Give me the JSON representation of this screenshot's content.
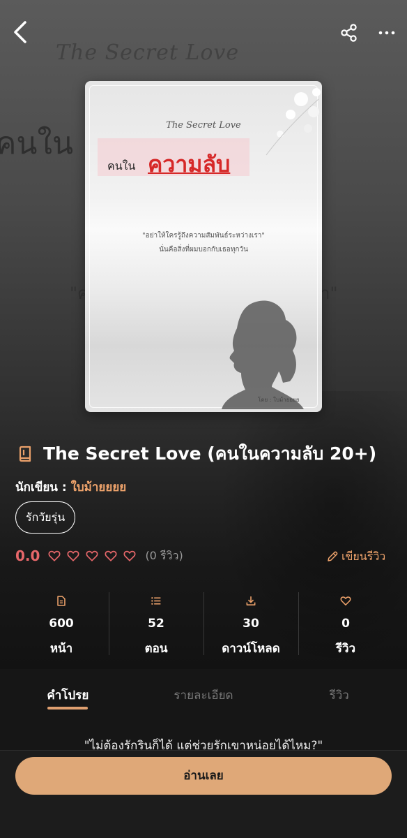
{
  "background": {
    "ghost_title": "The Secret Love",
    "ghost_thai": "คนใน",
    "ghost_quote_left": "\"ค",
    "ghost_quote_right": "า\""
  },
  "nav": {
    "back_icon": "chevron-left-icon",
    "share_icon": "share-icon",
    "more_icon": "more-horizontal-icon"
  },
  "cover": {
    "script_title": "The Secret Love",
    "thai_small": "คนใน",
    "thai_big": "ความลับ",
    "tagline_1": "\"อย่าให้ใครรู้ถึงความสัมพันธ์ระหว่างเรา\"",
    "tagline_2": "นั่นคือสิ่งที่ผมบอกกับเธอทุกวัน",
    "byline": "โดย : ใบม้ายยยย"
  },
  "book": {
    "title": "The Secret Love (คนในความลับ 20+)",
    "author_label": "นักเขียน :",
    "author_name": "ใบม้ายยยย",
    "tag": "รักวัยรุ่น",
    "rating": "0.0",
    "review_count": "(0 รีวิว)",
    "write_review": "เขียนรีวิว"
  },
  "stats": [
    {
      "icon": "document-icon",
      "value": "600",
      "label": "หน้า"
    },
    {
      "icon": "list-icon",
      "value": "52",
      "label": "ตอน"
    },
    {
      "icon": "download-icon",
      "value": "30",
      "label": "ดาวน์โหลด"
    },
    {
      "icon": "heart-icon",
      "value": "0",
      "label": "รีวิว"
    }
  ],
  "tabs": [
    {
      "label": "คำโปรย",
      "active": true
    },
    {
      "label": "รายละเอียด",
      "active": false
    },
    {
      "label": "รีวิว",
      "active": false
    }
  ],
  "blurb": "\"ไม่ต้องรักรินก็ได้ แต่ช่วยรักเขาหน่อยได้ไหม?\"",
  "read_button": "อ่านเลย",
  "colors": {
    "accent": "#f0a46c",
    "rating": "#e7676a",
    "button": "#dfa878"
  }
}
